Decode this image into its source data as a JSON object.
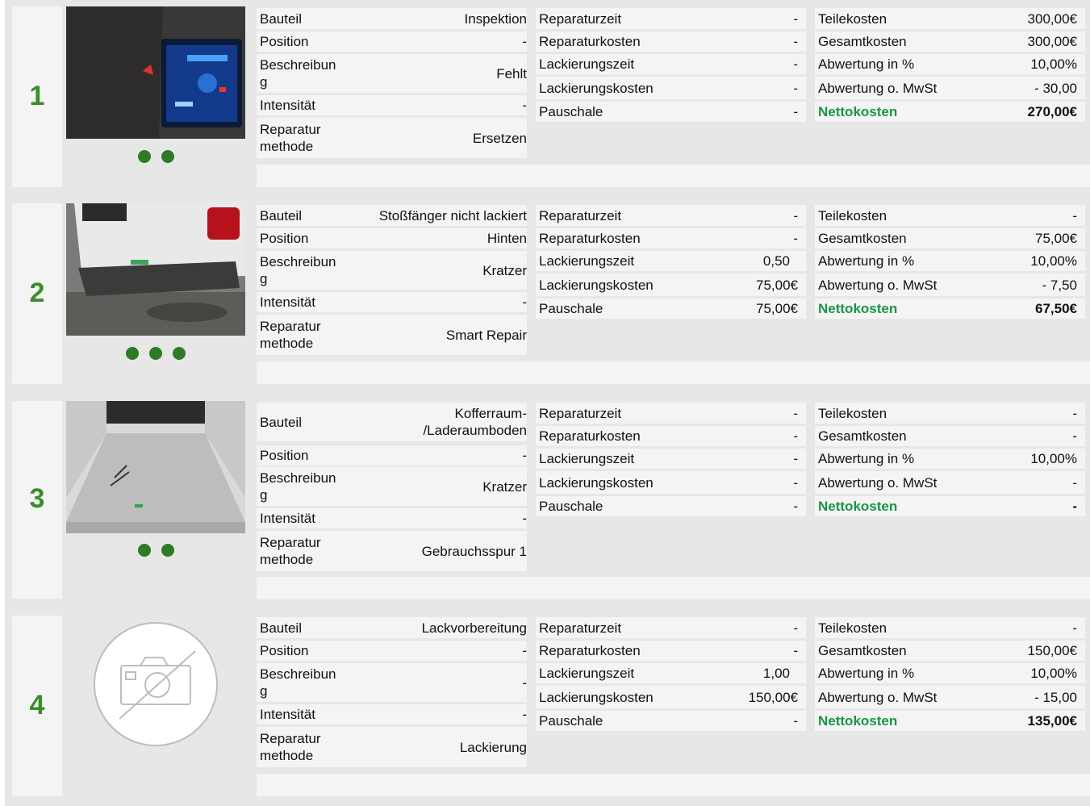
{
  "items": [
    {
      "number": "1",
      "photo_icon": "dashboard-photo",
      "dots": 2,
      "bauteil": "Inspektion",
      "position": "-",
      "beschreibung": "Fehlt",
      "intensitaet": "-",
      "methode": "Ersetzen",
      "reparaturzeit": "-",
      "reparaturkosten": "-",
      "lackierungszeit": "-",
      "lackierungskosten": "-",
      "pauschale": "-",
      "teilekosten": "300,00€",
      "gesamtkosten": "300,00€",
      "abwertung_prozent": "10,00%",
      "abwertung_mwst": "- 30,00",
      "nettokosten": "270,00€"
    },
    {
      "number": "2",
      "photo_icon": "rear-bumper-photo",
      "dots": 3,
      "bauteil": "Stoßfänger nicht lackiert",
      "position": "Hinten",
      "beschreibung": "Kratzer",
      "intensitaet": "-",
      "methode": "Smart Repair",
      "reparaturzeit": "-",
      "reparaturkosten": "-",
      "lackierungszeit": "0,50",
      "lackierungskosten": "75,00€",
      "pauschale": "75,00€",
      "teilekosten": "-",
      "gesamtkosten": "75,00€",
      "abwertung_prozent": "10,00%",
      "abwertung_mwst": "- 7,50",
      "nettokosten": "67,50€"
    },
    {
      "number": "3",
      "photo_icon": "cargo-floor-photo",
      "dots": 2,
      "bauteil": "Kofferraum-/Laderaumboden",
      "bauteil_line1": "Kofferraum-",
      "bauteil_line2": "/Laderaumboden",
      "position": "-",
      "beschreibung": "Kratzer",
      "intensitaet": "-",
      "methode": "Gebrauchsspur 1",
      "reparaturzeit": "-",
      "reparaturkosten": "-",
      "lackierungszeit": "-",
      "lackierungskosten": "-",
      "pauschale": "-",
      "teilekosten": "-",
      "gesamtkosten": "-",
      "abwertung_prozent": "10,00%",
      "abwertung_mwst": "-",
      "nettokosten": "-"
    },
    {
      "number": "4",
      "photo_icon": "no-photo-icon",
      "dots": 0,
      "bauteil": "Lackvorbereitung",
      "position": "-",
      "beschreibung": "-",
      "intensitaet": "-",
      "methode": "Lackierung",
      "reparaturzeit": "-",
      "reparaturkosten": "-",
      "lackierungszeit": "1,00",
      "lackierungskosten": "150,00€",
      "pauschale": "-",
      "teilekosten": "-",
      "gesamtkosten": "150,00€",
      "abwertung_prozent": "10,00%",
      "abwertung_mwst": "- 15,00",
      "nettokosten": "135,00€"
    }
  ],
  "labels": {
    "bauteil": "Bauteil",
    "position": "Position",
    "beschreibung_1": "Beschreibun",
    "beschreibung_2": "g",
    "intensitaet": "Intensität",
    "methode_1": "Reparatur",
    "methode_2": "methode",
    "reparaturzeit": "Reparaturzeit",
    "reparaturkosten": "Reparaturkosten",
    "lackierungszeit": "Lackierungszeit",
    "lackierungskosten": "Lackierungskosten",
    "pauschale": "Pauschale",
    "teilekosten": "Teilekosten",
    "gesamtkosten": "Gesamtkosten",
    "abwertung_prozent": "Abwertung in %",
    "abwertung_mwst": "Abwertung o. MwSt",
    "nettokosten": "Nettokosten"
  },
  "colors": {
    "accent_green": "#3a8e2a",
    "netto_green": "#1b9447",
    "dot_green": "#2f7a26",
    "row_bg": "#f4f4f4",
    "frame_bg": "#e7e7e7"
  }
}
